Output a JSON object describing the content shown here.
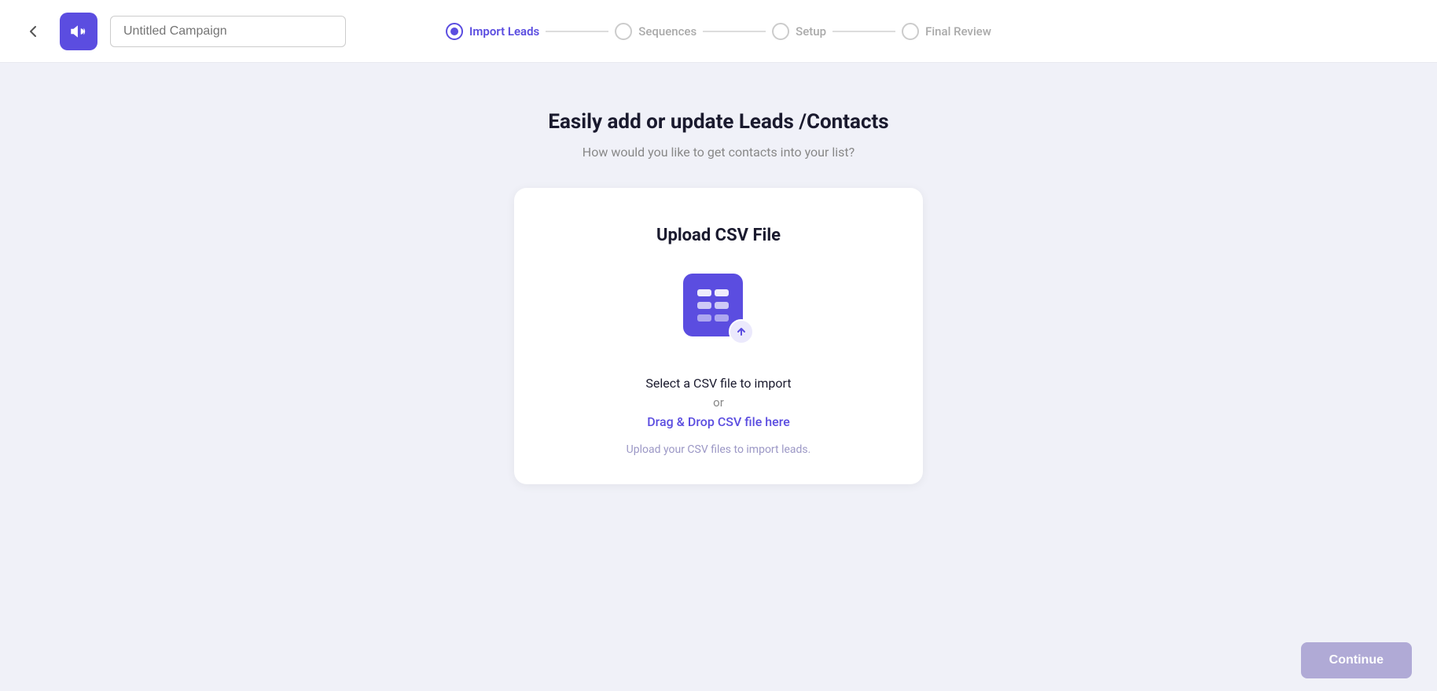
{
  "header": {
    "back_label": "←",
    "logo_icon": "megaphone",
    "campaign_placeholder": "Untitled Campaign"
  },
  "stepper": {
    "steps": [
      {
        "id": "import-leads",
        "label": "Import Leads",
        "active": true
      },
      {
        "id": "sequences",
        "label": "Sequences",
        "active": false
      },
      {
        "id": "setup",
        "label": "Setup",
        "active": false
      },
      {
        "id": "final-review",
        "label": "Final Review",
        "active": false
      }
    ]
  },
  "main": {
    "title": "Easily add or update Leads /Contacts",
    "subtitle": "How would you like to get contacts into your list?",
    "upload_card": {
      "title": "Upload CSV File",
      "select_text": "Select a CSV file to import",
      "or_text": "or",
      "drag_text": "Drag & Drop CSV file here",
      "hint": "Upload your CSV files to import leads."
    }
  },
  "footer": {
    "continue_label": "Continue"
  },
  "colors": {
    "brand_purple": "#5b4de0",
    "brand_light": "#ebe9fc",
    "text_dark": "#1a1a2e",
    "text_muted": "#888888",
    "text_hint": "#9b97c5",
    "continue_disabled": "#b0aad6"
  }
}
